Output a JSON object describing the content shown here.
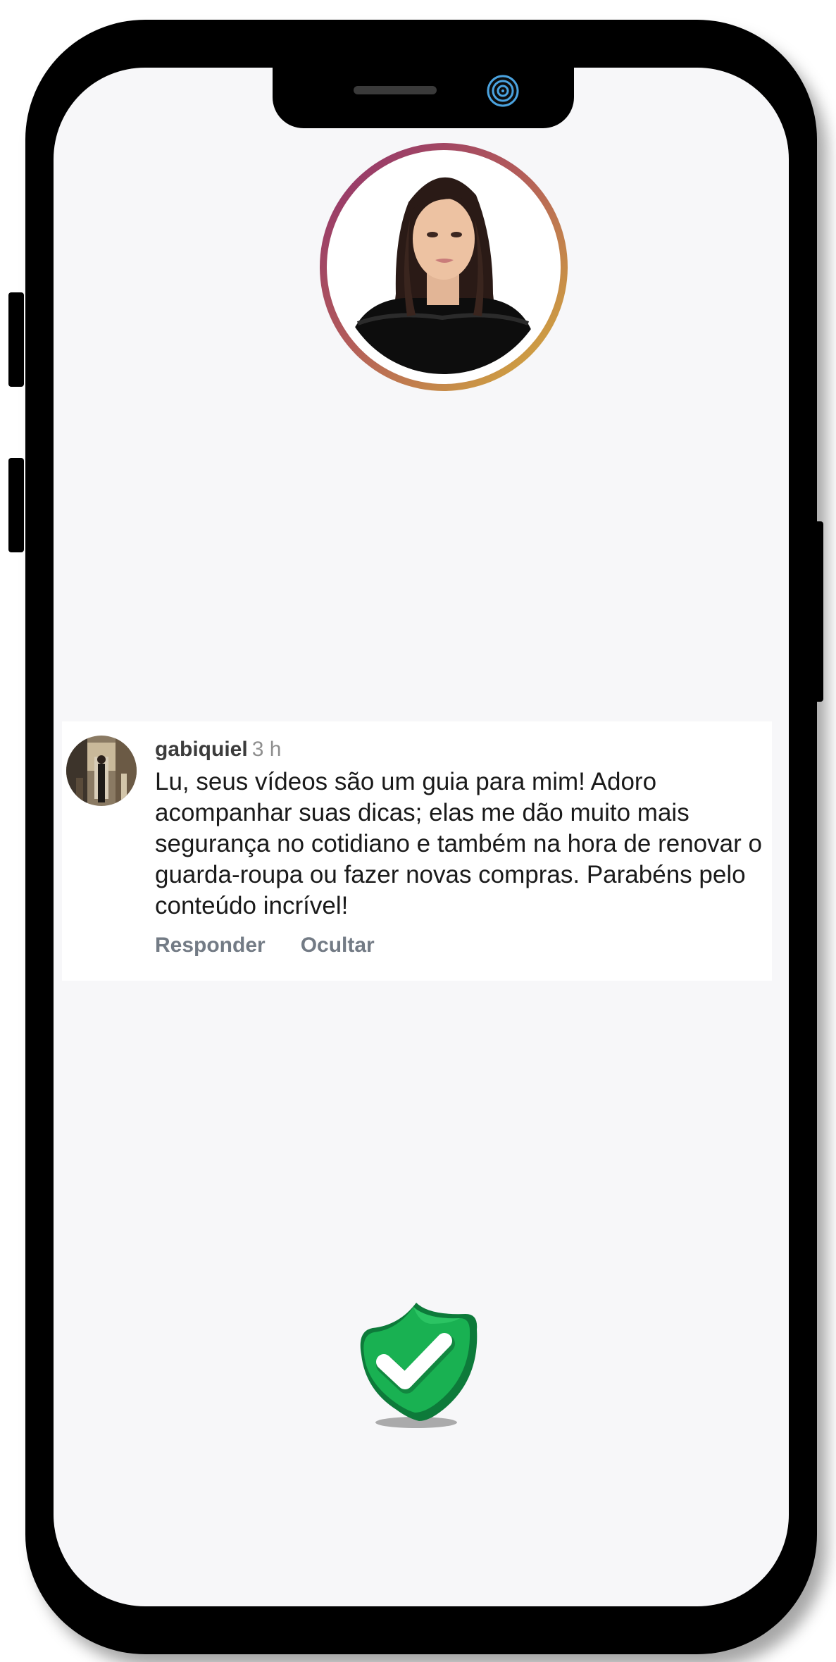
{
  "profile": {
    "ring_colors": [
      "#8e2f6f",
      "#b25a5a",
      "#d7b33b"
    ]
  },
  "comment": {
    "username": "gabiquiel",
    "time": "3 h",
    "text": "Lu, seus vídeos são um guia para mim! Adoro acompanhar suas dicas; elas me dão muito mais segurança no cotidiano e também na hora de renovar o guarda-roupa ou fazer novas compras. Parabéns pelo conteúdo incrível!",
    "actions": {
      "reply_label": "Responder",
      "hide_label": "Ocultar"
    }
  },
  "colors": {
    "screen_bg": "#f7f7f9",
    "shield_green": "#16a34a",
    "action_gray": "#737b85"
  },
  "icons": {
    "camera": "front-camera-icon",
    "shield": "verified-shield-check-icon"
  }
}
